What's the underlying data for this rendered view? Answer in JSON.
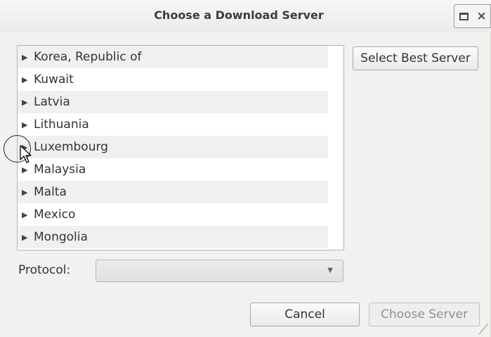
{
  "window": {
    "title": "Choose a Download Server",
    "close_glyph": "×"
  },
  "server_list": {
    "items": [
      {
        "label": "Korea, Republic of"
      },
      {
        "label": "Kuwait"
      },
      {
        "label": "Latvia"
      },
      {
        "label": "Lithuania"
      },
      {
        "label": "Luxembourg"
      },
      {
        "label": "Malaysia"
      },
      {
        "label": "Malta"
      },
      {
        "label": "Mexico"
      },
      {
        "label": "Mongolia"
      }
    ],
    "expander_glyph": "▶",
    "scroll_up_glyph": "▴",
    "scroll_down_glyph": "▾"
  },
  "buttons": {
    "select_best": "Select Best Server",
    "cancel": "Cancel",
    "choose": "Choose Server"
  },
  "protocol": {
    "label": "Protocol:",
    "value": "",
    "arrow_glyph": "▼"
  },
  "icons": {
    "maximize": "maximize-icon",
    "close": "close-icon",
    "expander": "triangle-right-icon",
    "cursor": "mouse-pointer-icon",
    "resize": "resize-grip-icon"
  },
  "colors": {
    "window_bg": "#f2f1f0",
    "list_alt_row": "#f0f0ef",
    "scroll_thumb": "#8a8a8a",
    "disabled_text": "#8f8f8f"
  }
}
